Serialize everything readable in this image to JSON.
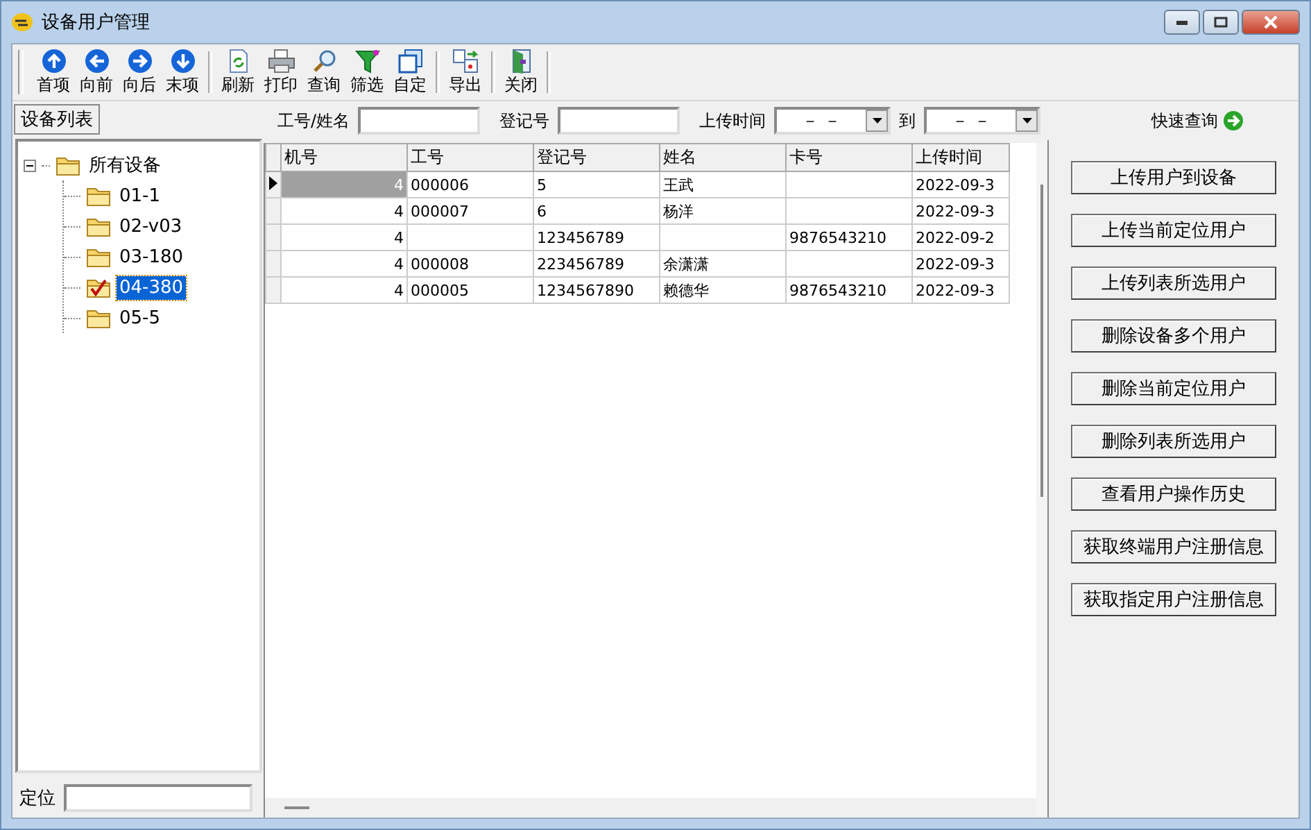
{
  "window": {
    "title": "设备用户管理"
  },
  "toolbar": [
    {
      "label": "首项",
      "kind": "up"
    },
    {
      "label": "向前",
      "kind": "left"
    },
    {
      "label": "向后",
      "kind": "right"
    },
    {
      "label": "末项",
      "kind": "down"
    },
    {
      "label": "刷新",
      "kind": "refresh",
      "group_start": true
    },
    {
      "label": "打印",
      "kind": "print"
    },
    {
      "label": "查询",
      "kind": "search"
    },
    {
      "label": "筛选",
      "kind": "filter"
    },
    {
      "label": "自定",
      "kind": "custom"
    },
    {
      "label": "导出",
      "kind": "export",
      "group_start": true
    },
    {
      "label": "关闭",
      "kind": "close",
      "group_start": true
    }
  ],
  "sidebar": {
    "tab": "设备列表",
    "tree": [
      {
        "label": "所有设备",
        "expanded": true,
        "selected": false,
        "children": [
          {
            "label": "01-1",
            "selected": false
          },
          {
            "label": "02-v03",
            "selected": false
          },
          {
            "label": "03-180",
            "selected": false
          },
          {
            "label": "04-380",
            "selected": true
          },
          {
            "label": "05-5",
            "selected": false
          }
        ]
      }
    ],
    "locate_label": "定位"
  },
  "filters": {
    "id_name_label": "工号/姓名",
    "reg_label": "登记号",
    "time_label": "上传时间",
    "time_from": "－ －",
    "to_label": "到",
    "time_to": "－ －",
    "quick_query": "快速查询"
  },
  "table": {
    "columns": [
      "机号",
      "工号",
      "登记号",
      "姓名",
      "卡号",
      "上传时间"
    ],
    "rows": [
      {
        "selected": true,
        "cells": [
          "4",
          "000006",
          "5",
          "王武",
          "",
          "2022-09-3"
        ]
      },
      {
        "selected": false,
        "cells": [
          "4",
          "000007",
          "6",
          "杨洋",
          "",
          "2022-09-3"
        ]
      },
      {
        "selected": false,
        "cells": [
          "4",
          "",
          "123456789",
          "",
          "9876543210",
          "2022-09-2"
        ]
      },
      {
        "selected": false,
        "cells": [
          "4",
          "000008",
          "223456789",
          "余潇潇",
          "",
          "2022-09-3"
        ]
      },
      {
        "selected": false,
        "cells": [
          "4",
          "000005",
          "1234567890",
          "赖德华",
          "9876543210",
          "2022-09-3"
        ]
      }
    ]
  },
  "actions": [
    "上传用户到设备",
    "上传当前定位用户",
    "上传列表所选用户",
    "删除设备多个用户",
    "删除当前定位用户",
    "删除列表所选用户",
    "查看用户操作历史",
    "获取终端用户注册信息",
    "获取指定用户注册信息"
  ]
}
